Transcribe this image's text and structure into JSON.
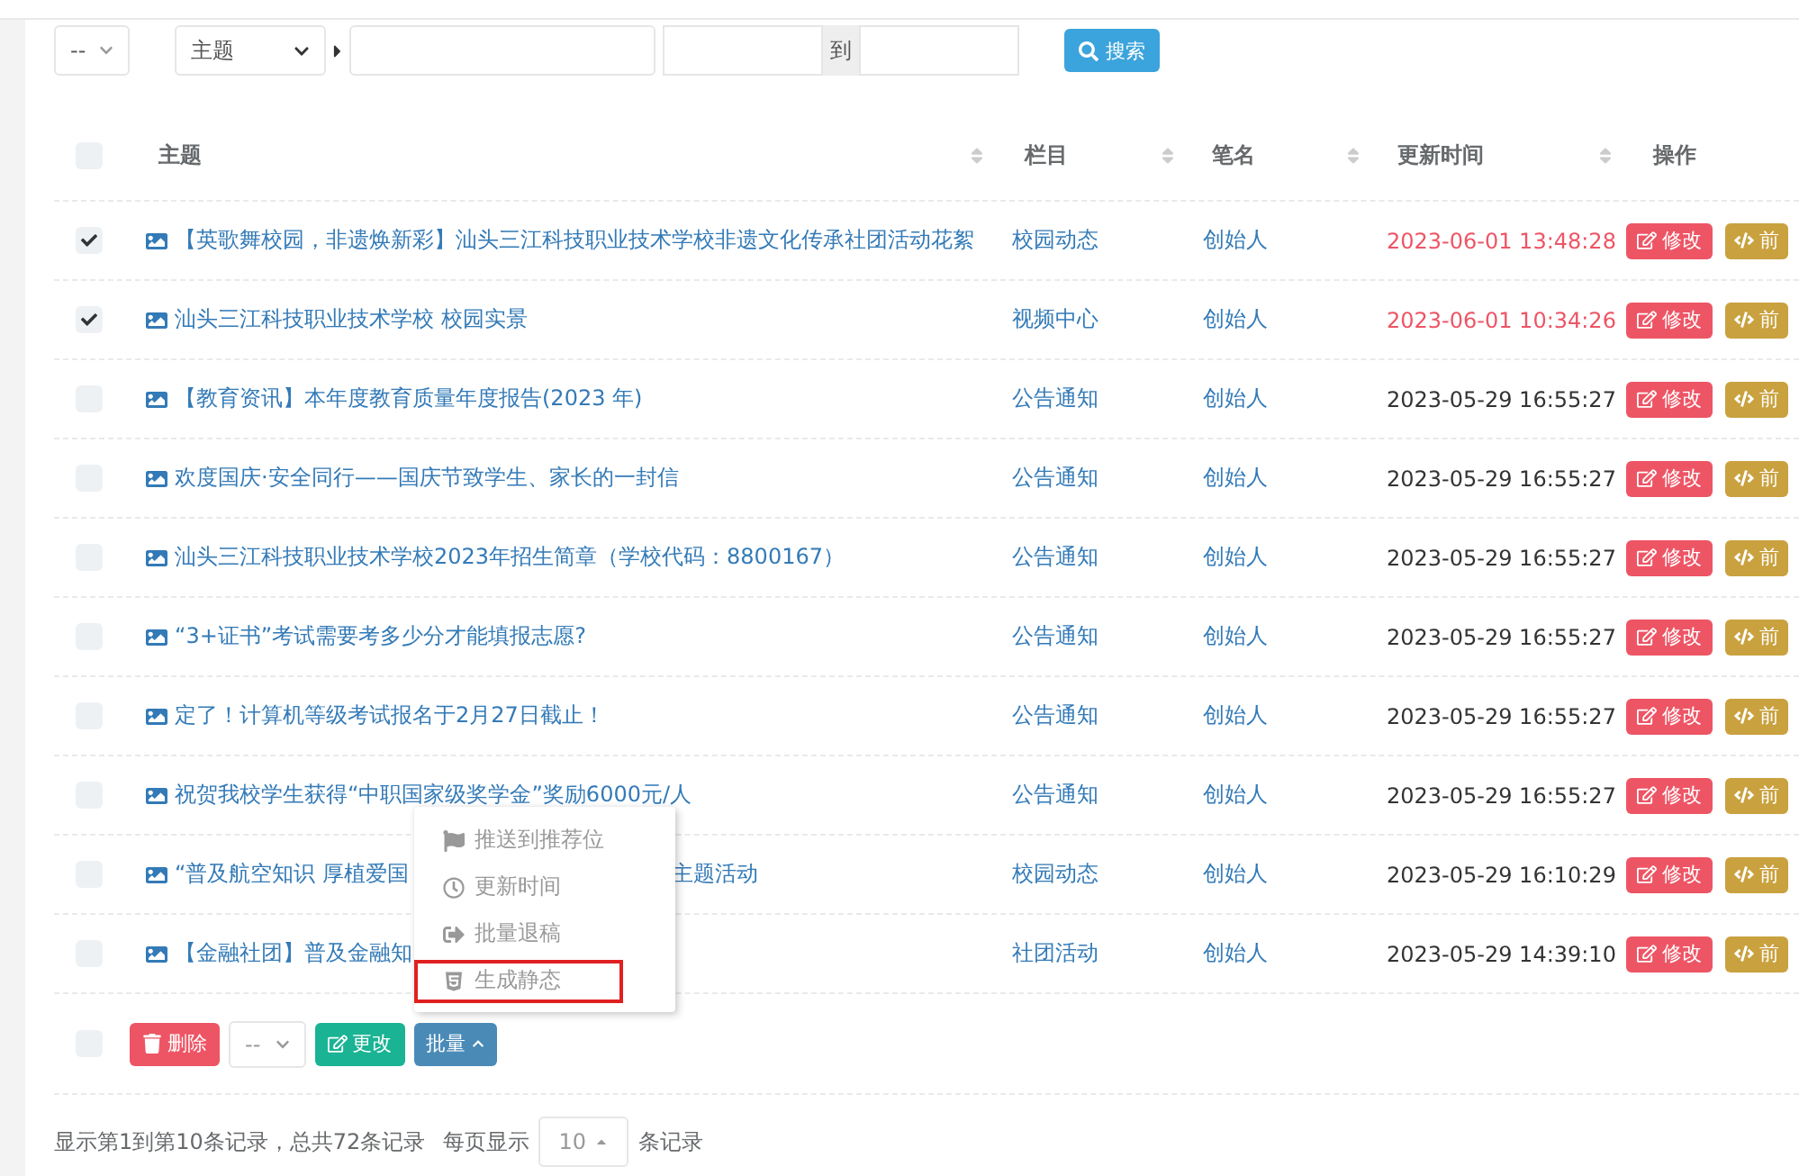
{
  "filters": {
    "status_select": "--",
    "field_select": "主题",
    "date_separator": "到",
    "search_button": "搜索"
  },
  "table": {
    "select_all": {
      "checked": false
    },
    "columns": [
      {
        "label": "主题",
        "sortable": true
      },
      {
        "label": "栏目",
        "sortable": true
      },
      {
        "label": "笔名",
        "sortable": true
      },
      {
        "label": "更新时间",
        "sortable": true
      },
      {
        "label": "操作",
        "sortable": false
      }
    ],
    "rows": [
      {
        "checked": true,
        "title": "【英歌舞校园，非遗焕新彩】汕头三江科技职业技术学校非遗文化传承社团活动花絮",
        "category": "校园动态",
        "author": "创始人",
        "updated": "2023-06-01 13:48:28",
        "recent": true,
        "actions": [
          "修改",
          "前"
        ]
      },
      {
        "checked": true,
        "title": "汕头三江科技职业技术学校 校园实景",
        "category": "视频中心",
        "author": "创始人",
        "updated": "2023-06-01 10:34:26",
        "recent": true,
        "actions": [
          "修改",
          "前"
        ]
      },
      {
        "checked": false,
        "title": "【教育资讯】本年度教育质量年度报告(2023 年)",
        "category": "公告通知",
        "author": "创始人",
        "updated": "2023-05-29 16:55:27",
        "recent": false,
        "actions": [
          "修改",
          "前"
        ]
      },
      {
        "checked": false,
        "title": "欢度国庆·安全同行——国庆节致学生、家长的一封信",
        "category": "公告通知",
        "author": "创始人",
        "updated": "2023-05-29 16:55:27",
        "recent": false,
        "actions": [
          "修改",
          "前"
        ]
      },
      {
        "checked": false,
        "title": "汕头三江科技职业技术学校2023年招生简章（学校代码：8800167）",
        "category": "公告通知",
        "author": "创始人",
        "updated": "2023-05-29 16:55:27",
        "recent": false,
        "actions": [
          "修改",
          "前"
        ]
      },
      {
        "checked": false,
        "title": "“3+证书”考试需要考多少分才能填报志愿?",
        "category": "公告通知",
        "author": "创始人",
        "updated": "2023-05-29 16:55:27",
        "recent": false,
        "actions": [
          "修改",
          "前"
        ]
      },
      {
        "checked": false,
        "title": "定了！计算机等级考试报名于2月27日截止！",
        "category": "公告通知",
        "author": "创始人",
        "updated": "2023-05-29 16:55:27",
        "recent": false,
        "actions": [
          "修改",
          "前"
        ]
      },
      {
        "checked": false,
        "title": "祝贺我校学生获得“中职国家级奖学金”奖励6000元/人",
        "category": "公告通知",
        "author": "创始人",
        "updated": "2023-05-29 16:55:27",
        "recent": false,
        "actions": [
          "修改",
          "前"
        ]
      },
      {
        "checked": false,
        "title": "“普及航空知识 厚植爱国",
        "title_tail": "主题活动",
        "category": "校园动态",
        "author": "创始人",
        "updated": "2023-05-29 16:10:29",
        "recent": false,
        "actions": [
          "修改",
          "前"
        ]
      },
      {
        "checked": false,
        "title": "【金融社团】普及金融知",
        "category": "社团活动",
        "author": "创始人",
        "updated": "2023-05-29 14:39:10",
        "recent": false,
        "actions": [
          "修改",
          "前"
        ]
      }
    ]
  },
  "bulk_bar": {
    "checked": false,
    "delete": "删除",
    "select": "--",
    "change": "更改",
    "batch": "批量",
    "expanded": true
  },
  "batch_menu": [
    {
      "label": "推送到推荐位",
      "highlighted": false
    },
    {
      "label": "更新时间",
      "highlighted": false
    },
    {
      "label": "批量退稿",
      "highlighted": false
    },
    {
      "label": "生成静态",
      "highlighted": true
    }
  ],
  "pagination": {
    "summary": "显示第1到第10条记录，总共72条记录",
    "per_page_label": "每页显示",
    "per_page": "10",
    "suffix": "条记录"
  }
}
